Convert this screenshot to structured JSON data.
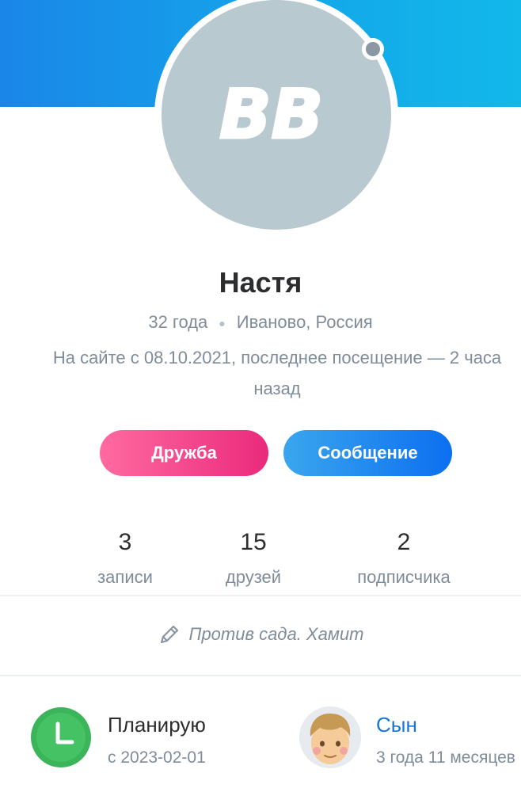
{
  "profile": {
    "avatar_monogram": "BB",
    "name": "Настя",
    "age": "32 года",
    "location": "Иваново, Россия",
    "seen": "На сайте с 08.10.2021, последнее посещение — 2 часа назад"
  },
  "actions": {
    "friend_label": "Дружба",
    "message_label": "Сообщение"
  },
  "stats": [
    {
      "value": "3",
      "label": "записи"
    },
    {
      "value": "15",
      "label": "друзей"
    },
    {
      "value": "2",
      "label": "подписчика"
    }
  ],
  "status_text": "Против сада. Хамит",
  "info": {
    "plan": {
      "title": "Планирую",
      "subtitle": "с 2023-02-01",
      "icon": "clock-icon"
    },
    "child": {
      "title": "Сын",
      "subtitle": "3 года 11 месяцев",
      "icon": "boy-avatar-icon"
    }
  },
  "colors": {
    "cover": "#1a86e8",
    "friend_button": "#ea2a7c",
    "message_button": "#0c6ff0",
    "clock_green": "#3cb45a",
    "link": "#1776d6"
  }
}
